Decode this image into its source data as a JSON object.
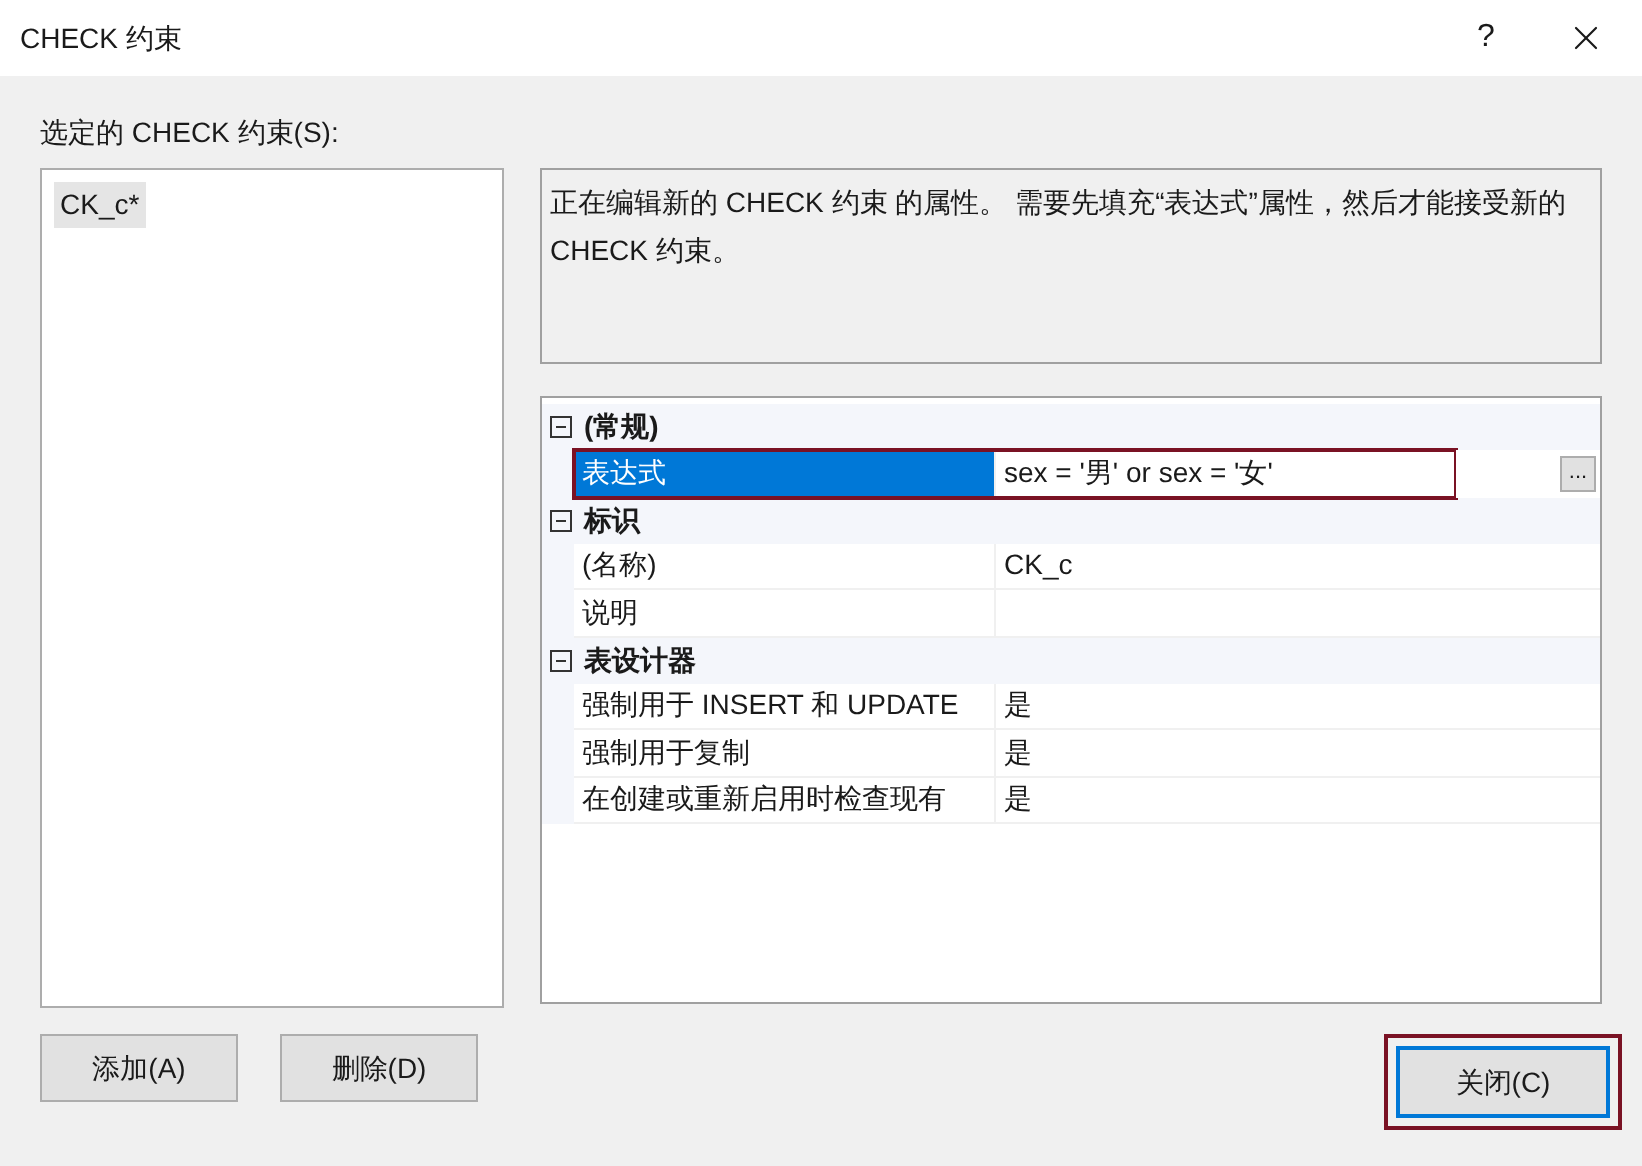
{
  "window": {
    "title": "CHECK 约束",
    "help": "?"
  },
  "constraints": {
    "label": "选定的 CHECK 约束(S):",
    "items": [
      {
        "name": "CK_c*",
        "selected": true
      }
    ]
  },
  "description": "正在编辑新的 CHECK 约束 的属性。  需要先填充“表达式”属性，然后才能接受新的 CHECK 约束。",
  "properties": [
    {
      "category": "(常规)",
      "expanded": true,
      "rows": [
        {
          "name": "表达式",
          "value": "sex = '男' or sex = '女'",
          "selected": true,
          "highlighted": true,
          "ellipsis": "..."
        }
      ]
    },
    {
      "category": "标识",
      "expanded": true,
      "rows": [
        {
          "name": "(名称)",
          "value": "CK_c",
          "selected": false,
          "highlighted": false
        },
        {
          "name": "说明",
          "selected": false,
          "highlighted": false
        }
      ]
    },
    {
      "category": "表设计器",
      "expanded": true,
      "rows": [
        {
          "name": "强制用于 INSERT 和 UPDATE",
          "value": "是",
          "selected": false,
          "highlighted": false
        },
        {
          "name": "强制用于复制",
          "value": "是",
          "selected": false,
          "highlighted": false
        },
        {
          "name": "在创建或重新启用时检查现有",
          "value": "是",
          "selected": false,
          "highlighted": false
        }
      ]
    }
  ],
  "buttons": [
    {
      "label": "添加(A)"
    },
    {
      "label": "删除(D)"
    }
  ],
  "close_button": {
    "label": "关闭(C)",
    "focused": true,
    "highlighted": true
  }
}
